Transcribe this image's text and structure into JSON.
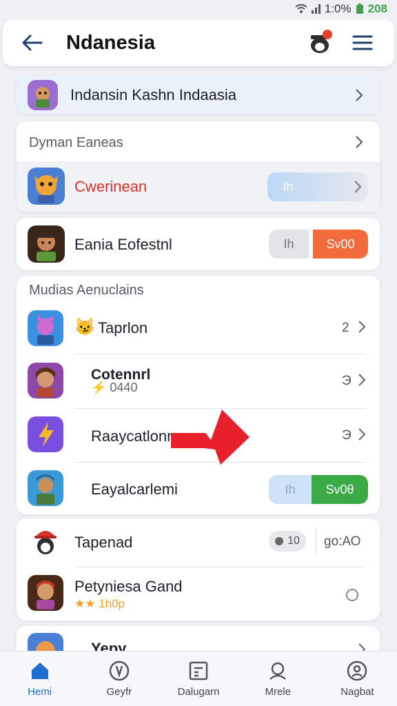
{
  "status": {
    "time": "1:0%",
    "battery": "208"
  },
  "header": {
    "title": "Ndanesia"
  },
  "featured": {
    "label": "Indansin Kashn Indaasia"
  },
  "section1": {
    "title": "Dyman Eaneas",
    "highlight": {
      "label": "Cwerinean",
      "pill": "Ih"
    }
  },
  "card2": {
    "label": "Eania Eofestnl",
    "pill_left": "Ih",
    "pill_right": "Sv00"
  },
  "section2": {
    "title": "Mudias Aenuclains",
    "items": [
      {
        "emoji": "😼",
        "label": "Taprlon",
        "count": "2"
      },
      {
        "label": "Cotennrl",
        "sub": "⚡ 0440",
        "count": "Э"
      },
      {
        "label": "Raaycatlonn",
        "count": "Э"
      },
      {
        "label": "Eayalcarlemi",
        "pill_left": "Ih",
        "pill_right": "Sv0θ"
      }
    ]
  },
  "card3": {
    "items": [
      {
        "label": "Tapenad",
        "badge": "10",
        "time": "go:ΑΟ"
      },
      {
        "label": "Petyniesa Gand",
        "rating": "★★ 1h0p"
      }
    ]
  },
  "card4": {
    "label": "Yepy"
  },
  "bottom_nav": [
    {
      "label": "Hemi",
      "icon": "home-icon",
      "active": true
    },
    {
      "label": "Geyfr",
      "icon": "compass-icon"
    },
    {
      "label": "Dalugarn",
      "icon": "calendar-icon"
    },
    {
      "label": "Mrele",
      "icon": "chat-person-icon"
    },
    {
      "label": "Nagbat",
      "icon": "profile-icon"
    }
  ],
  "colors": {
    "accent": "#1f6fd1",
    "red": "#e8302c",
    "orange": "#f26b3a",
    "green": "#3aaa46",
    "light_blue": "#cfe2f8"
  }
}
